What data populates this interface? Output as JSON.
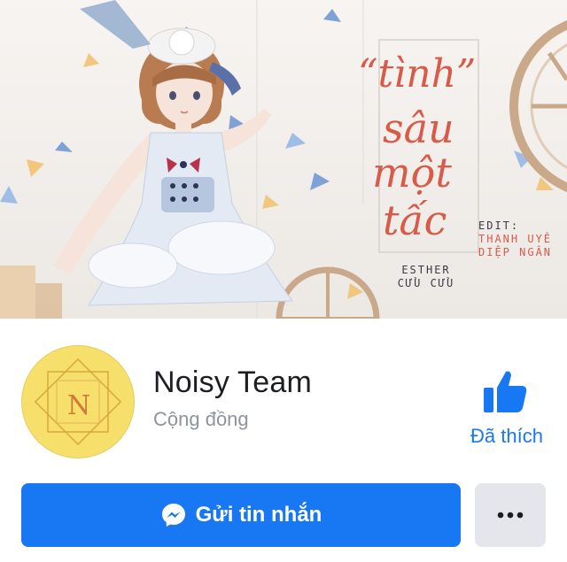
{
  "cover": {
    "title_lines": [
      "“tình”",
      "sâu",
      "một",
      "tấc"
    ],
    "author_line1": "ESTHER",
    "author_line2": "CỬU CỬU",
    "edit_label": "EDIT:",
    "editor1": "THANH UYÊ",
    "editor2": "DIỆP NGÂN"
  },
  "profile": {
    "avatar_letters": "N",
    "name": "Noisy Team",
    "category": "Cộng đồng"
  },
  "like": {
    "label": "Đã thích",
    "icon": "thumbs-up-icon"
  },
  "actions": {
    "message_label": "Gửi tin nhắn",
    "message_icon": "messenger-icon",
    "more_icon": "more-dots-icon"
  },
  "colors": {
    "accent": "#1877f2",
    "name": "#1c1e21",
    "secondary": "#8d949e",
    "more_bg": "#e4e6eb",
    "avatar_bg": "#f7df6c"
  }
}
